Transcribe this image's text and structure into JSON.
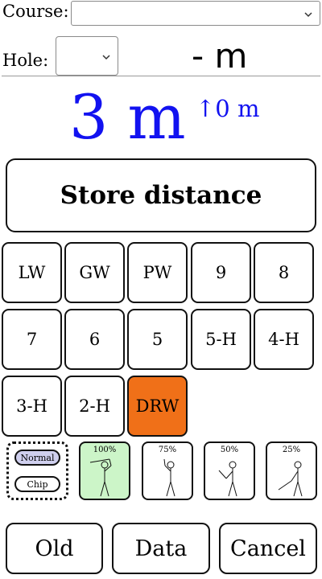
{
  "course": {
    "label": "Course:",
    "value": ""
  },
  "hole": {
    "label": "Hole:",
    "value": "",
    "distance": "- m"
  },
  "distance": {
    "main": "3 m",
    "delta": "↑0 m"
  },
  "store_label": "Store distance",
  "clubs": [
    {
      "label": "LW",
      "selected": false
    },
    {
      "label": "GW",
      "selected": false
    },
    {
      "label": "PW",
      "selected": false
    },
    {
      "label": "9",
      "selected": false
    },
    {
      "label": "8",
      "selected": false
    },
    {
      "label": "7",
      "selected": false
    },
    {
      "label": "6",
      "selected": false
    },
    {
      "label": "5",
      "selected": false
    },
    {
      "label": "5-H",
      "selected": false
    },
    {
      "label": "4-H",
      "selected": false
    },
    {
      "label": "3-H",
      "selected": false
    },
    {
      "label": "2-H",
      "selected": false
    },
    {
      "label": "DRW",
      "selected": true
    }
  ],
  "modes": [
    {
      "label": "Normal",
      "active": true
    },
    {
      "label": "Chip",
      "active": false
    }
  ],
  "swing_power": [
    {
      "label": "100%",
      "active": true,
      "icon": "full-swing-icon"
    },
    {
      "label": "75%",
      "active": false,
      "icon": "three-quarter-swing-icon"
    },
    {
      "label": "50%",
      "active": false,
      "icon": "half-swing-icon"
    },
    {
      "label": "25%",
      "active": false,
      "icon": "quarter-swing-icon"
    }
  ],
  "actions": {
    "old": "Old",
    "data": "Data",
    "cancel": "Cancel"
  },
  "colors": {
    "distance": "#1212f0",
    "selected_club": "#f07018",
    "active_mode": "#cfcfee",
    "active_power": "#ccf5c8"
  }
}
